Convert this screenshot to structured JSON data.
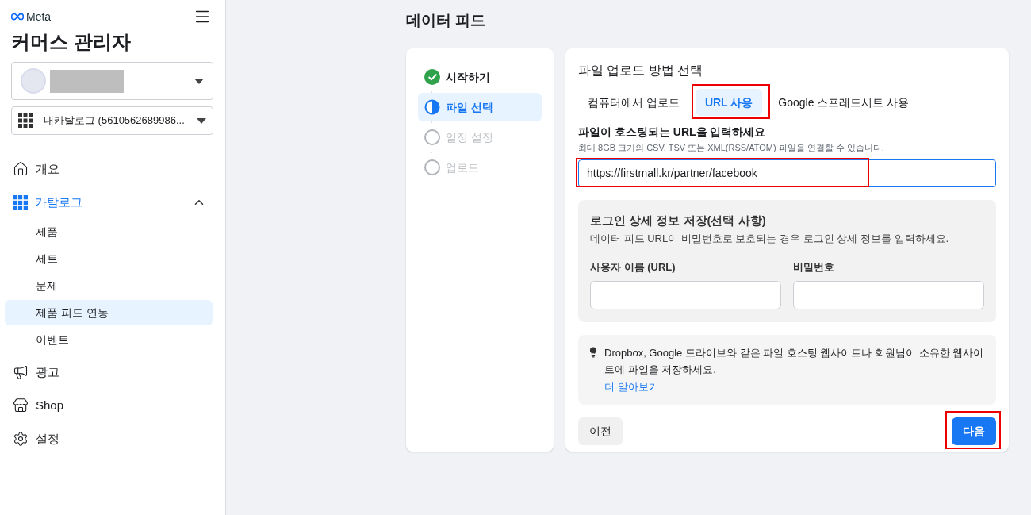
{
  "sidebar": {
    "brand": "Meta",
    "title": "커머스 관리자",
    "account_select": {
      "name_hidden": true
    },
    "catalog_select": {
      "value": "내카탈로그 (5610562689986..."
    },
    "nav": [
      {
        "kind": "home",
        "label": "개요",
        "selected": false
      },
      {
        "kind": "catalog",
        "label": "카탈로그",
        "selected": false,
        "expanded": true,
        "children": [
          {
            "label": "제품",
            "selected": false
          },
          {
            "label": "세트",
            "selected": false
          },
          {
            "label": "문제",
            "selected": false
          },
          {
            "label": "제품 피드 연동",
            "selected": true
          },
          {
            "label": "이벤트",
            "selected": false
          }
        ]
      },
      {
        "kind": "ads",
        "label": "광고",
        "selected": false
      },
      {
        "kind": "shop",
        "label": "Shop",
        "selected": false
      },
      {
        "kind": "settings",
        "label": "설정",
        "selected": false
      }
    ]
  },
  "page_title": "데이터 피드",
  "steps": [
    {
      "label": "시작하기",
      "kind": "done",
      "selected": false
    },
    {
      "label": "파일 선택",
      "kind": "current",
      "selected": true
    },
    {
      "label": "일정 설정",
      "kind": "pending",
      "selected": false
    },
    {
      "label": "업로드",
      "kind": "pending",
      "selected": false
    }
  ],
  "upload": {
    "heading": "파일 업로드 방법 선택",
    "tabs": [
      {
        "label": "컴퓨터에서 업로드",
        "selected": false,
        "annotated": false
      },
      {
        "label": "URL 사용",
        "selected": true,
        "annotated": true
      },
      {
        "label": "Google 스프레드시트 사용",
        "selected": false,
        "annotated": false
      }
    ],
    "url_label": "파일이 호스팅되는 URL을 입력하세요",
    "url_hint": "최대 8GB 크기의 CSV, TSV 또는 XML(RSS/ATOM) 파일을 연결할 수 있습니다.",
    "url_value": "https://firstmall.kr/partner/facebook",
    "url_annotated": true,
    "login": {
      "title": "로그인 상세 정보 저장(선택 사항)",
      "description": "데이터 피드 URL이 비밀번호로 보호되는 경우 로그인 상세 정보를 입력하세요.",
      "fields": [
        {
          "label": "사용자 이름 (URL)"
        },
        {
          "label": "비밀번호"
        }
      ]
    },
    "tip": {
      "text": "Dropbox, Google 드라이브와 같은 파일 호스팅 웹사이트나 회원님이 소유한 웹사이트에 파일을 저장하세요.",
      "link": "더 알아보기"
    },
    "back_button": "이전",
    "next_button": "다음",
    "next_annotated": true
  }
}
